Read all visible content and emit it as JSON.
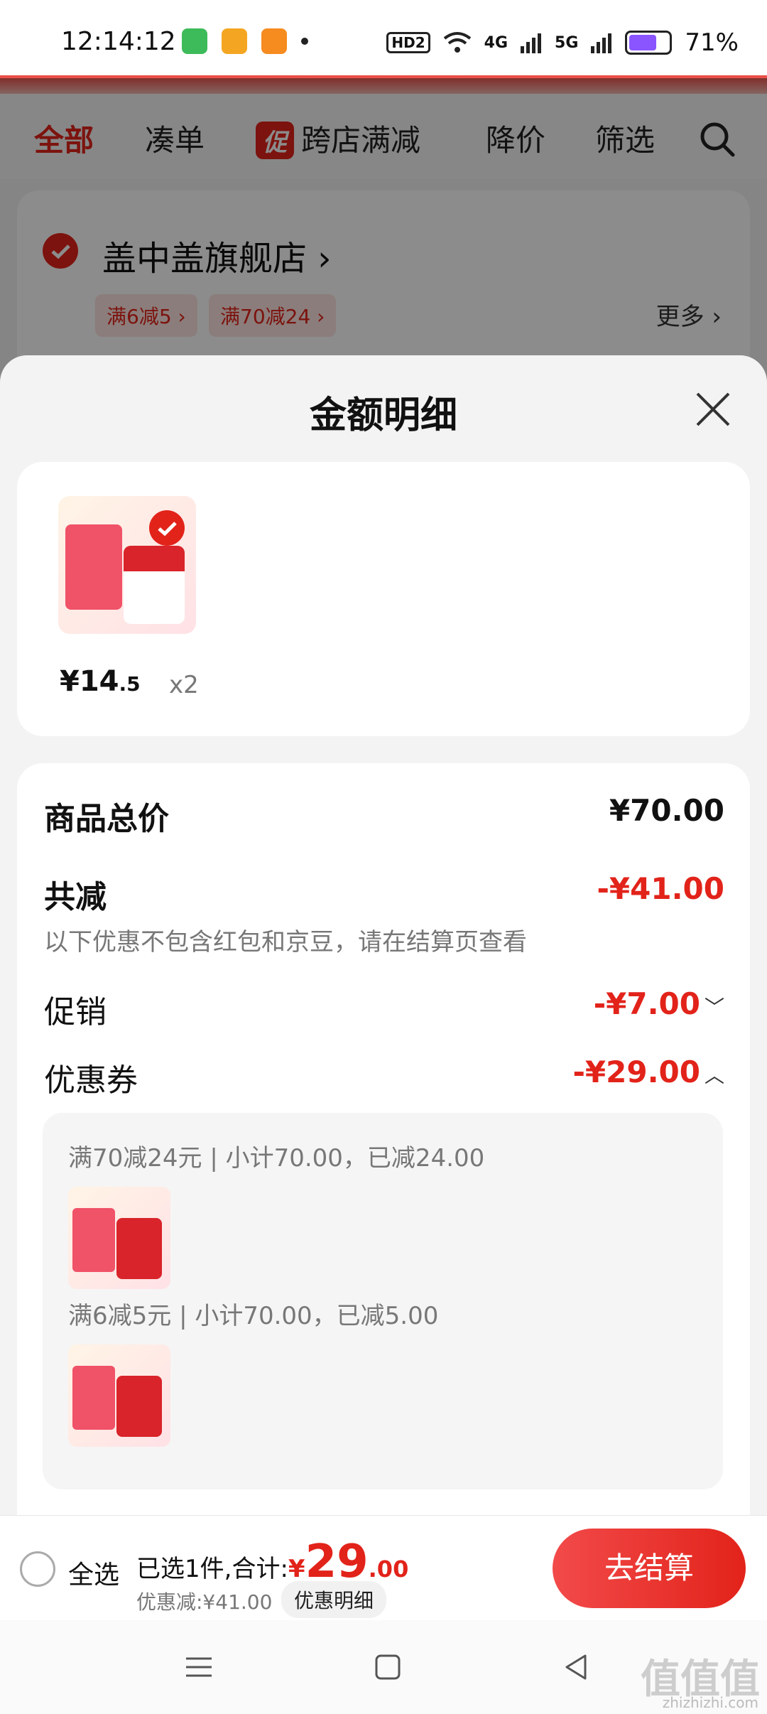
{
  "status": {
    "time": "12:14:12",
    "hd": "HD2",
    "net4g": "4G",
    "net5g": "5G",
    "battery": "71%"
  },
  "tabs": {
    "all": "全部",
    "bundle": "凑单",
    "promo_badge": "促",
    "cross_store": "跨店满减",
    "price_drop": "降价",
    "filter": "筛选"
  },
  "store": {
    "name": "盖中盖旗舰店",
    "chip1": "满6减5",
    "chip2": "满70减24",
    "more": "更多"
  },
  "sheet": {
    "title": "金额明细"
  },
  "product": {
    "price_main": "¥14",
    "price_decimal": ".5",
    "qty": "x2"
  },
  "detail": {
    "total_label": "商品总价",
    "total_value": "¥70.00",
    "reduce_label": "共减",
    "reduce_value": "-¥41.00",
    "note": "以下优惠不包含红包和京豆，请在结算页查看",
    "promo_label": "促销",
    "promo_value": "-¥7.00",
    "coupon_label": "优惠券",
    "coupon_value": "-¥29.00",
    "coupon1": "满70减24元 | 小计70.00，已减24.00",
    "coupon2": "满6减5元 | 小计70.00，已减5.00"
  },
  "bottom": {
    "select_all": "全选",
    "summary_prefix": "已选1件,合计:",
    "currency": "¥",
    "total_big": "29",
    "total_small": ".00",
    "discount": "优惠减:¥41.00",
    "detail_button": "优惠明细",
    "checkout": "去结算"
  },
  "watermark": {
    "text": "值值值",
    "sub": "zhizhizhi.com"
  },
  "colors": {
    "accent": "#e2231a"
  }
}
